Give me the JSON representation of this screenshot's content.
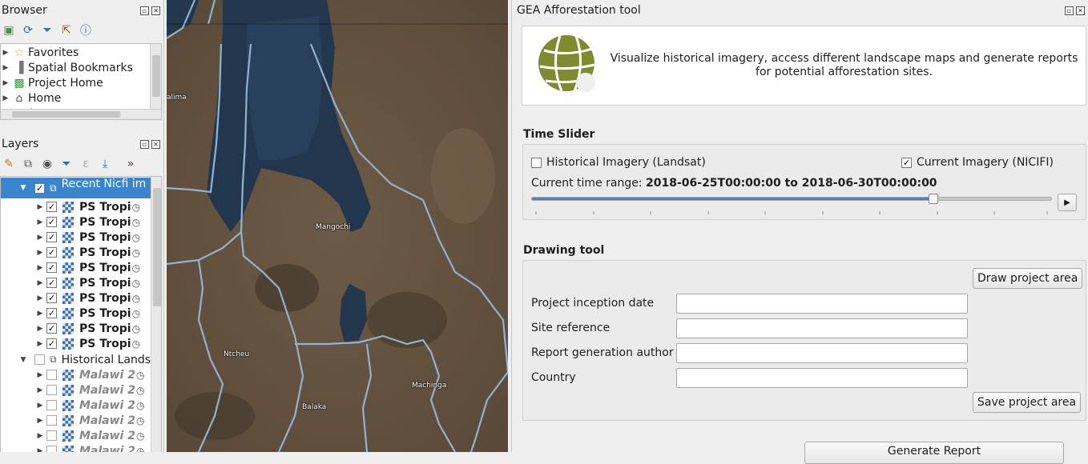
{
  "browser_panel": {
    "title": "Browser",
    "items": [
      {
        "label": "Favorites",
        "icon": "star-icon"
      },
      {
        "label": "Spatial Bookmarks",
        "icon": "bookmark-icon"
      },
      {
        "label": "Project Home",
        "icon": "project-home-icon"
      },
      {
        "label": "Home",
        "icon": "home-folder-icon"
      },
      {
        "label": "/",
        "icon": "folder-icon"
      }
    ]
  },
  "layers_panel": {
    "title": "Layers",
    "group1": {
      "label": "Recent Nicfi im"
    },
    "layers": [
      "PS Tropi",
      "PS Tropi",
      "PS Tropi",
      "PS Tropi",
      "PS Tropi",
      "PS Tropi",
      "PS Tropi",
      "PS Tropi",
      "PS Tropi",
      "PS Tropi"
    ],
    "group2": {
      "label": "Historical Lands"
    },
    "historical_layers": [
      "Malawi 2",
      "Malawi 2",
      "Malawi 2",
      "Malawi 2",
      "Malawi 2",
      "Malawi 2"
    ]
  },
  "map": {
    "labels": {
      "lalima": "alima",
      "mangochi": "Mangochi",
      "ntcheu": "Ntcheu",
      "machinga": "Machinga",
      "balaka": "Balaka"
    }
  },
  "plugin": {
    "title": "GEA Afforestation tool",
    "description": "Visualize historical imagery, access different landscape maps and generate reports for potential afforestation sites.",
    "time_slider": {
      "section_title": "Time Slider",
      "historical_label": "Historical Imagery (Landsat)",
      "historical_checked": false,
      "current_label": "Current Imagery (NICIFI)",
      "current_checked": true,
      "range_prefix": "Current time range: ",
      "range_value": "2018-06-25T00:00:00 to 2018-06-30T00:00:00",
      "slider_fraction": 0.77
    },
    "drawing_tool": {
      "section_title": "Drawing tool",
      "draw_button": "Draw project area",
      "fields": [
        {
          "label": "Project inception date",
          "value": ""
        },
        {
          "label": "Site reference",
          "value": ""
        },
        {
          "label": "Report generation author",
          "value": ""
        },
        {
          "label": "Country",
          "value": ""
        }
      ],
      "save_button": "Save project area"
    },
    "generate_button": "Generate Report"
  }
}
